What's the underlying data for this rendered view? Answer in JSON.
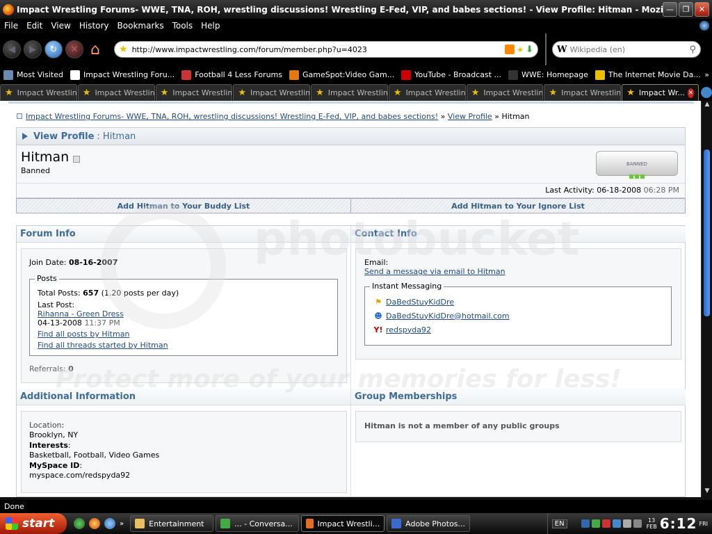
{
  "window": {
    "title": "Impact Wrestling Forums- WWE, TNA, ROH, wrestling discussions! Wrestling E-Fed, VIP, and babes sections! - View Profile: Hitman - Mozilla Firefox"
  },
  "menu": [
    "File",
    "Edit",
    "View",
    "History",
    "Bookmarks",
    "Tools",
    "Help"
  ],
  "nav": {
    "url": "http://www.impactwrestling.com/forum/member.php?u=4023",
    "search_placeholder": "Wikipedia (en)"
  },
  "bookmarks": [
    {
      "label": "Most Visited",
      "icon": "bookmarks-folder-icon",
      "color": "#6a8ab0"
    },
    {
      "label": "Impact Wrestling Foru...",
      "icon": "google-icon",
      "color": "#ffffff"
    },
    {
      "label": "Football 4 Less Forums",
      "icon": "football-icon",
      "color": "#cc3333"
    },
    {
      "label": "GameSpot:Video Gam...",
      "icon": "gamespot-icon",
      "color": "#e07a10"
    },
    {
      "label": "YouTube - Broadcast ...",
      "icon": "youtube-icon",
      "color": "#cc0000"
    },
    {
      "label": "WWE: Homepage",
      "icon": "wwe-icon",
      "color": "#333333"
    },
    {
      "label": "The Internet Movie Da...",
      "icon": "imdb-icon",
      "color": "#e8c000"
    }
  ],
  "tabs": [
    "Impact Wrestlin...",
    "Impact Wrestlin...",
    "Impact Wrestlin...",
    "Impact Wrestlin...",
    "Impact Wrestlin...",
    "Impact Wrestlin...",
    "Impact Wrestlin...",
    "Impact Wrestlin...",
    "Impact Wr..."
  ],
  "page": {
    "breadcrumb": {
      "forum": "Impact Wrestling Forums- WWE, TNA, ROH, wrestling discussions! Wrestling E-Fed, VIP, and babes sections!",
      "sep": "»",
      "section": "View Profile",
      "current": "Hitman"
    },
    "view_profile_label": "View Profile",
    "view_profile_name": ": Hitman",
    "username": "Hitman",
    "usertitle": "Banned",
    "rank_image_text": "BANNED",
    "last_activity_label": "Last Activity:",
    "last_activity_date": "06-18-2008",
    "last_activity_time": "06:28 PM",
    "add_buddy": "Add Hitman to Your Buddy List",
    "add_ignore": "Add Hitman to Your Ignore List",
    "forum_info": {
      "heading": "Forum Info",
      "join_label": "Join Date:",
      "join_date": "08-16-2007",
      "posts_legend": "Posts",
      "total_label": "Total Posts:",
      "total_posts": "657",
      "per_day": "(1.20 posts per day)",
      "last_post_label": "Last Post:",
      "last_post_title": "Rihanna - Green Dress",
      "last_post_date": "04-13-2008",
      "last_post_time": "11:37 PM",
      "find_posts": "Find all posts by Hitman",
      "find_threads": "Find all threads started by Hitman",
      "referrals_label": "Referrals:",
      "referrals": "0"
    },
    "contact_info": {
      "heading": "Contact Info",
      "email_label": "Email:",
      "email_link": "Send a message via email to Hitman",
      "im_legend": "Instant Messaging",
      "im": [
        {
          "icon": "aim-icon",
          "handle": "DaBedStuyKidDre"
        },
        {
          "icon": "msn-icon",
          "handle": "DaBedStuyKidDre@hotmail.com"
        },
        {
          "icon": "yahoo-icon",
          "handle": "redspyda92"
        }
      ]
    },
    "additional": {
      "heading": "Additional Information",
      "location_label": "Location",
      "location": "Brooklyn, NY",
      "interests_label": "Interests",
      "interests": "Basketball, Football, Video Games",
      "myspace_label": "MySpace ID",
      "myspace": "myspace.com/redspyda92",
      "colon": ":"
    },
    "groups": {
      "heading": "Group Memberships",
      "text": "Hitman is not a member of any public groups"
    }
  },
  "watermark": {
    "logo": "photobucket",
    "tagline": "Protect more of your memories for less!"
  },
  "status": "Done",
  "taskbar": {
    "start": "start",
    "windows": [
      {
        "label": "Entertainment",
        "icon": "folder-icon",
        "color": "#e8c060"
      },
      {
        "label": "... - Conversa...",
        "icon": "messenger-icon",
        "color": "#4a4"
      },
      {
        "label": "Impact Wrestli...",
        "icon": "firefox-icon",
        "color": "#e07020"
      },
      {
        "label": "Adobe Photos...",
        "icon": "photoshop-icon",
        "color": "#3a6ad0"
      }
    ],
    "lang": "EN",
    "date_day": "13",
    "date_month": "FEB",
    "time": "6:12",
    "weekday": "FRI"
  }
}
